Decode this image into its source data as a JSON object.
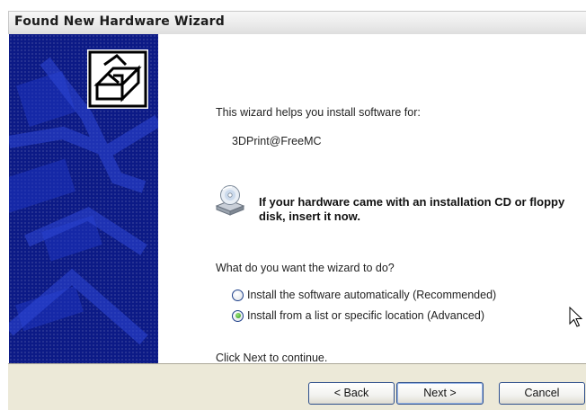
{
  "window": {
    "title": "Found New Hardware Wizard"
  },
  "content": {
    "intro": "This wizard helps you install software for:",
    "device_name": "3DPrint@FreeMC",
    "cd_prompt": "If your hardware came with an installation CD or floppy disk, insert it now.",
    "question": "What do you want the wizard to do?",
    "options": [
      {
        "label": "Install the software automatically (Recommended)",
        "selected": false
      },
      {
        "label": "Install from a list or specific location (Advanced)",
        "selected": true
      }
    ],
    "footer_text": "Click Next to continue."
  },
  "buttons": {
    "back": "< Back",
    "next": "Next >",
    "cancel": "Cancel"
  },
  "icons": {
    "hardware": "hardware-wizard-icon",
    "cd": "cd-drive-icon",
    "cursor": "mouse-pointer-icon"
  },
  "colors": {
    "sidebar": "#0c1a86",
    "button_bar": "#ece9d8",
    "radio_selected": "#2f9c1c"
  }
}
